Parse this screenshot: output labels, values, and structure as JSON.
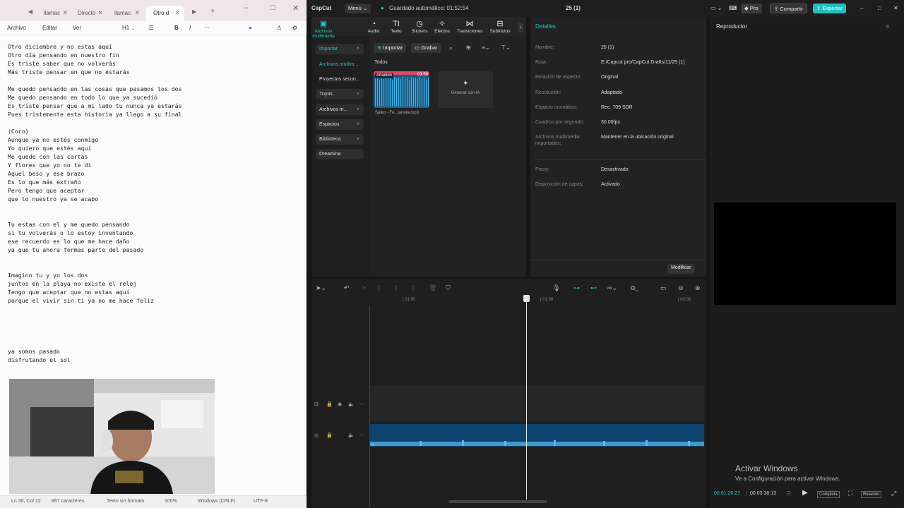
{
  "notepad": {
    "tabs": [
      "llamac",
      "Directo",
      "llamac",
      "Otro d"
    ],
    "menu": {
      "archivo": "Archivo",
      "editar": "Editar",
      "ver": "Ver",
      "heading": "H1"
    },
    "lines": [
      "Otro diciembre y no estas aquí",
      "Otro día pensando en nuestro fin",
      "Es triste saber que no volverás",
      "Más triste pensar en que no estarás",
      "",
      "Me quedo pensando en las cosas que pasamos los dos",
      "Me quedo pensando en todo lo que ya sucedió",
      "Es triste pensar que a mi lado tu nunca ya estarás",
      "Pues tristemente esta historia ya llego a su final",
      "",
      "(Coro)",
      "Aunque ya no estés conmigo",
      "Yo quiero que estés aquí",
      "Me quede con las cartas",
      "Y flores que yo no te di",
      "Aquel beso y ese brazo",
      "Es lo que más extraño",
      "Pero tengo que aceptar",
      "que lo nuestro ya se acabo",
      "",
      "",
      "Tu estas con el y me quedo pensando",
      "si tu volverás o lo estoy inventando",
      "ese recuerdo es lo que me hace daño",
      "ya que tu ahora formas parte del pasado",
      "",
      "",
      "Imagino tu y yo los dos",
      "juntos en la playa no existe el reloj",
      "Tengo que aceptar que no estas aquí",
      "porque el vivir sin ti ya no me hace feliz",
      "",
      "",
      "",
      "",
      "",
      "ya somos pasado",
      "disfrutando el sol"
    ],
    "status": {
      "position": "Ln 30, Col 22",
      "chars": "867 caracteres.",
      "format": "Texto sin formato",
      "zoom": "100%",
      "eol": "Windows (CRLF)",
      "encoding": "UTF-8"
    }
  },
  "capcut": {
    "logo": "CapCut",
    "menu": "Menú",
    "autosave": "Guardado automático: 01:52:54",
    "project": "25 (1)",
    "pro": "Pro",
    "share": "Compartir",
    "export": "Exportar",
    "tools": [
      {
        "label": "Archivos multimedia",
        "icon": "media-icon"
      },
      {
        "label": "Audio",
        "icon": "audio-icon"
      },
      {
        "label": "Texto",
        "icon": "text-icon"
      },
      {
        "label": "Stickers",
        "icon": "sticker-icon"
      },
      {
        "label": "Efectos",
        "icon": "effects-icon"
      },
      {
        "label": "Transiciones",
        "icon": "transitions-icon"
      },
      {
        "label": "Subtítulos",
        "icon": "subtitles-icon"
      }
    ],
    "sidebar": [
      "Importar",
      "Archivos multim...",
      "Proyectos secun...",
      "Tuyos",
      "Archivos m...",
      "Espacios",
      "Biblioteca",
      "Dreamina"
    ],
    "media": {
      "import": "Importar",
      "record": "Grabar",
      "all": "Todos",
      "clip_badge": "Añadido",
      "clip_duration": "03:59",
      "clip_name": "Saiko - Fe...laneta.mp3",
      "ai": "Generar con IA"
    },
    "details": {
      "title": "Detalles",
      "rows": [
        {
          "k": "Nombre:",
          "v": "25 (1)"
        },
        {
          "k": "Ruta:",
          "v": "E:/Capcut pro/CapCut Drafts/11/25 (1)"
        },
        {
          "k": "Relación de aspecto:",
          "v": "Original"
        },
        {
          "k": "Resolución:",
          "v": "Adaptado"
        },
        {
          "k": "Espacio cromático:",
          "v": "Rec. 709 SDR"
        },
        {
          "k": "Cuadros por segundo:",
          "v": "30.00fps"
        },
        {
          "k": "Archivos multimedia importados:",
          "v": "Mantener en la ubicación original"
        },
        {
          "k": "Proxy:",
          "v": "Desactivado"
        },
        {
          "k": "Disposición de capas:",
          "v": "Activado"
        }
      ],
      "modify": "Modificar"
    },
    "player": {
      "title": "Reproductor",
      "current": "00:01:26:27",
      "total": "00:03:38:13",
      "full": "Completa",
      "ratio": "Relación"
    },
    "timeline": {
      "ticks": [
        "| 01:00",
        "| 01:30",
        "| 02:00"
      ]
    },
    "watermark": {
      "title": "Activar Windows",
      "subtitle": "Ve a Configuración para activar Windows."
    }
  }
}
